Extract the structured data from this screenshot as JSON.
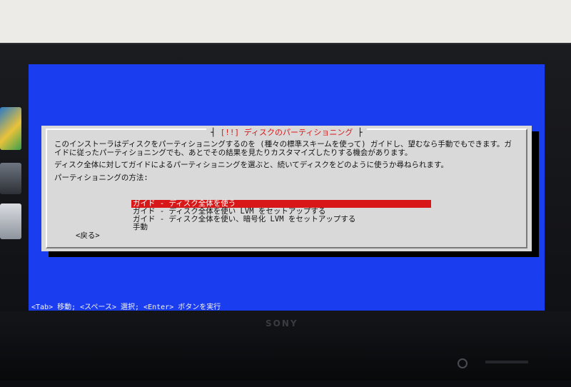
{
  "monitor": {
    "brand": "SONY"
  },
  "dialog": {
    "title_number": "[!!]",
    "title": "ディスクのパーティショニング",
    "paragraph1": "このインストーラはディスクをパーティショニングするのを (種々の標準スキームを使って) ガイドし、望むなら手動でもできます。ガイドに従ったパーティショニングでも、あとでその結果を見たりカスタマイズしたりする機会があります。",
    "paragraph2": "ディスク全体に対してガイドによるパーティショニングを選ぶと、続いてディスクをどのように使うか尋ねられます。",
    "method_label": "パーティショニングの方法:",
    "options": [
      {
        "label": "ガイド - ディスク全体を使う",
        "selected": true
      },
      {
        "label": "ガイド - ディスク全体を使い LVM をセットアップする",
        "selected": false
      },
      {
        "label": "ガイド - ディスク全体を使い、暗号化 LVM をセットアップする",
        "selected": false
      },
      {
        "label": "手動",
        "selected": false
      }
    ],
    "back_label": "<戻る>"
  },
  "statusbar": {
    "text": "<Tab> 移動; <スペース> 選択; <Enter> ボタンを実行"
  },
  "colors": {
    "screen_bg": "#1b3df0",
    "dialog_bg": "#d9d9d9",
    "highlight": "#d81818"
  }
}
